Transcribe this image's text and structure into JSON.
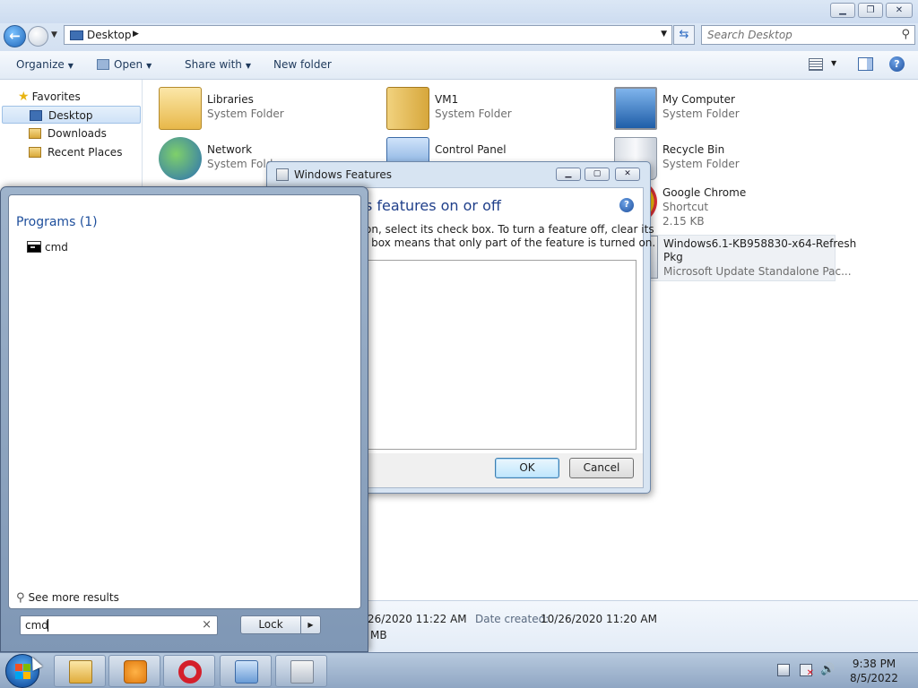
{
  "explorer": {
    "address": {
      "crumb": "Desktop"
    },
    "search": {
      "placeholder": "Search Desktop"
    },
    "toolbar": {
      "organize": "Organize",
      "open": "Open",
      "share_with": "Share with",
      "new_folder": "New folder"
    },
    "nav": {
      "favorites": "Favorites",
      "items": [
        {
          "label": "Desktop",
          "selected": true
        },
        {
          "label": "Downloads"
        },
        {
          "label": "Recent Places"
        }
      ]
    },
    "items": [
      {
        "name": "Libraries",
        "type": "System Folder",
        "icon": "libraries-icon"
      },
      {
        "name": "VM1",
        "type": "System Folder",
        "icon": "user-folder-icon"
      },
      {
        "name": "My Computer",
        "type": "System Folder",
        "icon": "computer-icon"
      },
      {
        "name": "Network",
        "type": "System Folder",
        "icon": "network-icon"
      },
      {
        "name": "Control Panel",
        "type": "",
        "icon": "control-panel-icon"
      },
      {
        "name": "Recycle Bin",
        "type": "System Folder",
        "icon": "recycle-bin-icon"
      },
      {
        "name": "Google Chrome",
        "type": "Shortcut",
        "size": "2.15 KB",
        "icon": "chrome-icon"
      },
      {
        "name": "Windows6.1-KB958830-x64-Refresh",
        "name2": "Pkg",
        "type": "Microsoft Update Standalone Pac...",
        "icon": "update-package-icon"
      }
    ],
    "details": {
      "modified": "26/2020 11:22 AM",
      "created_label": "Date created:",
      "created": "10/26/2020 11:20 AM",
      "size": "MB"
    }
  },
  "dialog": {
    "title": "Windows Features",
    "heading": "s features on or off",
    "desc_line1": "on, select its check box. To turn a feature off, clear its",
    "desc_line2": "l box means that only part of the feature is turned on.",
    "ok": "OK",
    "cancel": "Cancel"
  },
  "startmenu": {
    "programs_heading": "Programs (1)",
    "results": [
      {
        "label": "cmd"
      }
    ],
    "see_more": "See more results",
    "search_value": "cmd",
    "lock": "Lock"
  },
  "taskbar": {
    "apps": [
      "explorer-icon",
      "media-player-icon",
      "opera-icon",
      "control-panel-icon",
      "installer-icon"
    ],
    "time": "9:38 PM",
    "date": "8/5/2022"
  },
  "colors": {
    "accent_blue": "#1e4f9c",
    "heading_blue": "#1f3f8a",
    "taskbar": "#8fa6c3"
  }
}
